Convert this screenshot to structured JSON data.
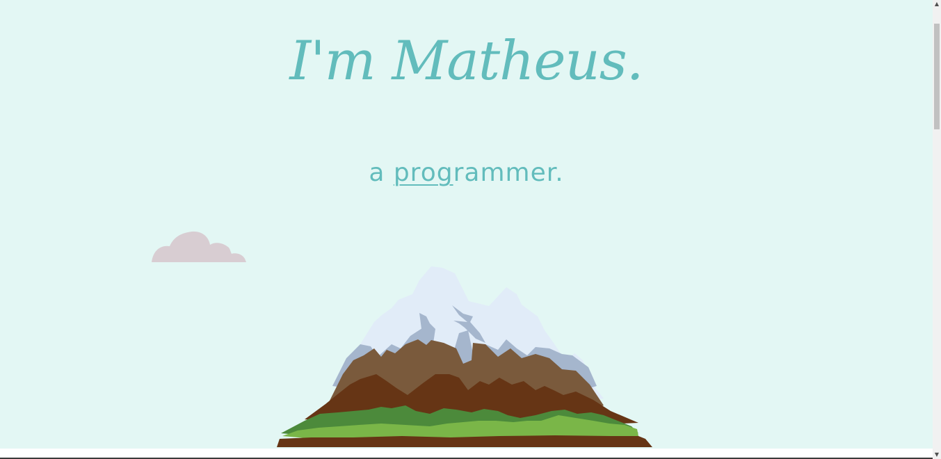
{
  "hero": {
    "title": "I'm Matheus."
  },
  "tagline": {
    "prefix": "a ",
    "underlined": "prog",
    "rest": "rammer."
  },
  "scrollbar": {
    "up_arrow": "▲",
    "down_arrow": "▼",
    "position_fraction": 0.05
  },
  "colors": {
    "background": "#e3f7f4",
    "accent": "#62bcbc",
    "cloud": "#d8cdd2",
    "snow": "#e1ecf8",
    "shadow": "#a5b6cd",
    "rock_light": "#7a5a3c",
    "rock_dark": "#663515",
    "grass_dark": "#4c8a3b",
    "grass_light": "#7ab648"
  },
  "icons": {
    "cloud": "cloud-icon",
    "mountain": "mountain-illustration"
  }
}
